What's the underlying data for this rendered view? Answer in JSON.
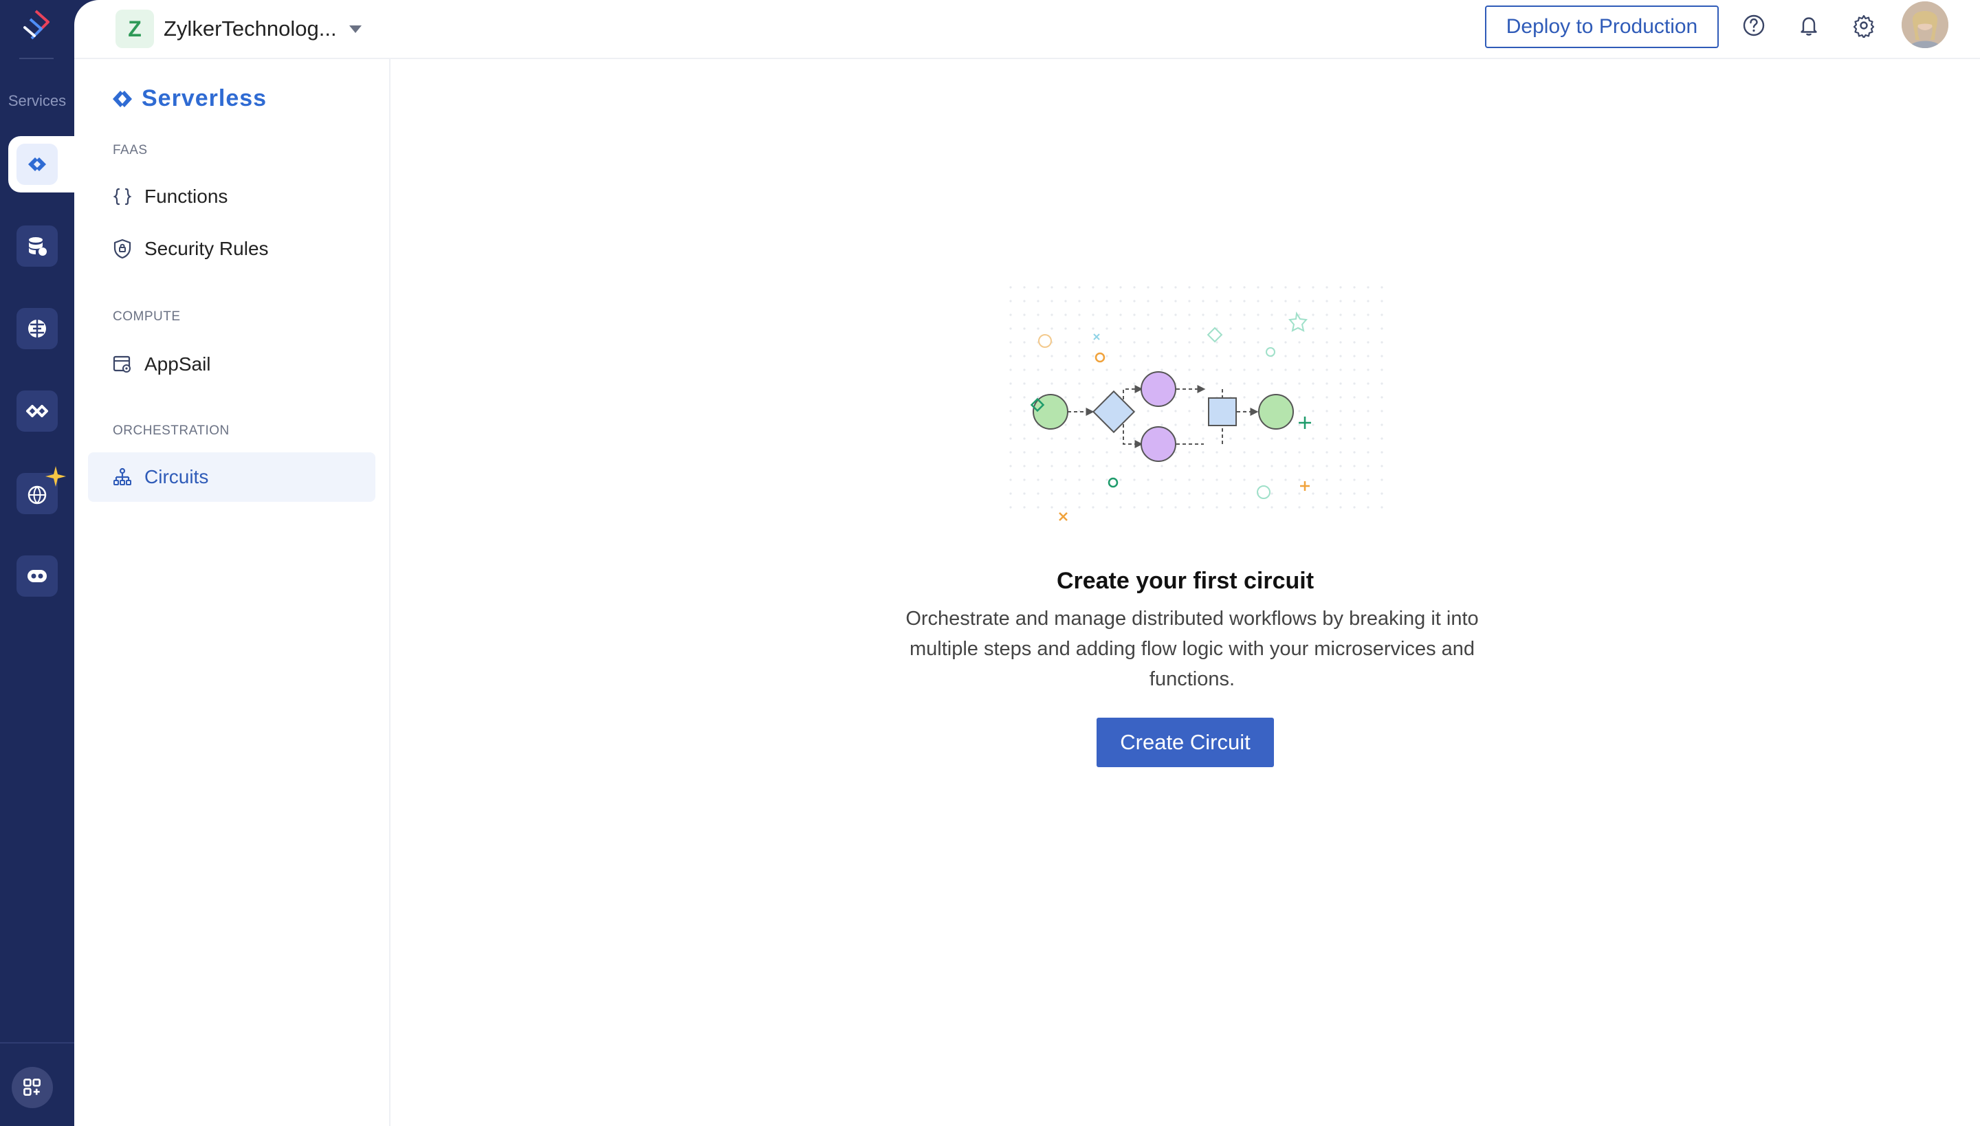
{
  "rail": {
    "label": "Services",
    "icons": [
      "zoho-catalyst-logo",
      "serverless-icon",
      "cloudscale-icon",
      "quickml-icon",
      "devops-icon",
      "globe-sparkle-icon",
      "slate-icon"
    ]
  },
  "topbar": {
    "org_initial": "Z",
    "org_name": "ZylkerTechnolog...",
    "deploy_label": "Deploy to Production"
  },
  "sidebar": {
    "title": "Serverless",
    "sections": [
      {
        "label": "FAAS",
        "items": [
          "Functions",
          "Security Rules"
        ]
      },
      {
        "label": "COMPUTE",
        "items": [
          "AppSail"
        ]
      },
      {
        "label": "ORCHESTRATION",
        "items": [
          "Circuits"
        ]
      }
    ],
    "active_item": "Circuits"
  },
  "main": {
    "empty_title": "Create your first circuit",
    "empty_description": "Orchestrate and manage distributed workflows by breaking it into multiple steps and adding flow logic with your microservices and functions.",
    "create_label": "Create Circuit"
  },
  "colors": {
    "rail_bg": "#1d2a5c",
    "accent": "#2f5bb8",
    "primary_button": "#3a63c4"
  }
}
